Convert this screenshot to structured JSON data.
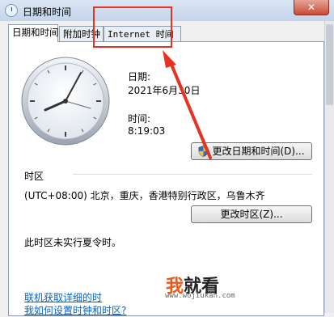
{
  "window": {
    "title": "日期和时间",
    "close_label": "✕",
    "icon": "clock-app-icon"
  },
  "tabs": [
    {
      "label": "日期和时间",
      "active": true
    },
    {
      "label": "附加时钟",
      "active": false
    },
    {
      "label": "Internet 时间",
      "active": false
    }
  ],
  "datetime": {
    "date_label": "日期:",
    "date_value": "2021年6月30日",
    "time_label": "时间:",
    "time_value": "8:19:03",
    "change_button": "更改日期和时间(D)...",
    "change_button_icon": "uac-shield-icon"
  },
  "timezone": {
    "section_label": "时区",
    "value": "(UTC+08:00) 北京，重庆，香港特别行政区，乌鲁木齐",
    "change_button": "更改时区(Z)...",
    "dst_note": "此时区未实行夏令时。"
  },
  "links": [
    "联机获取详细的时",
    "我如何设置时钟和时区?"
  ],
  "annotation": {
    "color": "#e53223"
  },
  "watermark": {
    "first_char": "我",
    "rest": "就看",
    "url": "www.wojiukan.com"
  }
}
